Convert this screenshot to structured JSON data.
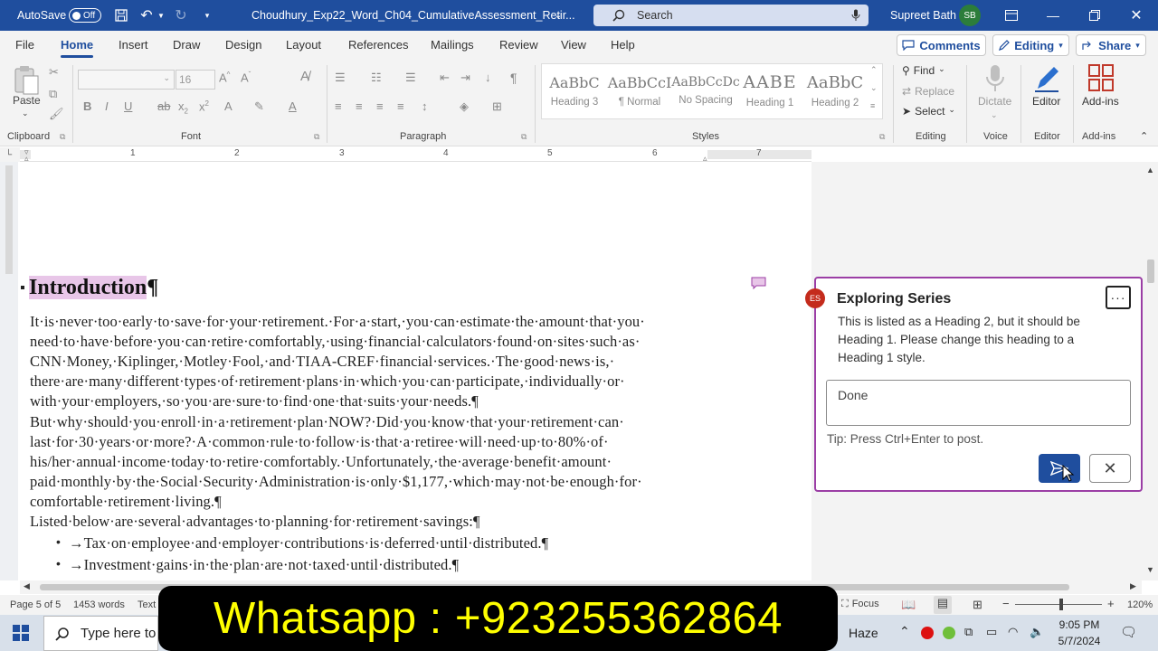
{
  "titlebar": {
    "autosave_label": "AutoSave",
    "autosave_state": "Off",
    "doc_title": "Choudhury_Exp22_Word_Ch04_CumulativeAssessment_Retir...",
    "search_placeholder": "Search",
    "user_name": "Supreet Bath",
    "user_initials": "SB"
  },
  "menu": {
    "tabs": [
      "File",
      "Home",
      "Insert",
      "Draw",
      "Design",
      "Layout",
      "References",
      "Mailings",
      "Review",
      "View",
      "Help"
    ],
    "active_tab": "Home",
    "comments_label": "Comments",
    "editing_label": "Editing",
    "share_label": "Share"
  },
  "ribbon": {
    "clipboard": {
      "paste": "Paste",
      "label": "Clipboard"
    },
    "font": {
      "size": "16",
      "label": "Font"
    },
    "paragraph": {
      "label": "Paragraph"
    },
    "styles": {
      "label": "Styles",
      "items": [
        {
          "preview": "AaBbC",
          "name": "Heading 3"
        },
        {
          "preview": "AaBbCcI",
          "name": "¶ Normal"
        },
        {
          "preview": "AaBbCcDc",
          "name": "No Spacing"
        },
        {
          "preview": "AABE",
          "name": "Heading 1"
        },
        {
          "preview": "AaBbC",
          "name": "Heading 2"
        }
      ]
    },
    "editing": {
      "find": "Find",
      "replace": "Replace",
      "select": "Select",
      "label": "Editing"
    },
    "voice": {
      "dictate": "Dictate",
      "label": "Voice"
    },
    "editor": {
      "editor": "Editor",
      "label": "Editor"
    },
    "addins": {
      "addins": "Add-ins",
      "label": "Add-ins"
    }
  },
  "ruler": {
    "numbers": [
      "1",
      "2",
      "3",
      "4",
      "5",
      "6",
      "7"
    ]
  },
  "document": {
    "heading": "Introduction",
    "lines": [
      "It·is·never·too·early·to·save·for·your·retirement.·For·a·start,·you·can·estimate·the·amount·that·you·",
      "need·to·have·before·you·can·retire·comfortably,·using·financial·calculators·found·on·sites·such·as·",
      "CNN·Money,·Kiplinger,·Motley·Fool,·and·TIAA-CREF·financial·services.·The·good·news·is,·",
      "there·are·many·different·types·of·retirement·plans·in·which·you·can·participate,·individually·or·",
      "with·your·employers,·so·you·are·sure·to·find·one·that·suits·your·needs.¶",
      "But·why·should·you·enroll·in·a·retirement·plan·NOW?·Did·you·know·that·your·retirement·can·",
      "last·for·30·years·or·more?·A·common·rule·to·follow·is·that·a·retiree·will·need·up·to·80%·of·",
      "his/her·annual·income·today·to·retire·comfortably.·Unfortunately,·the·average·benefit·amount·",
      "paid·monthly·by·the·Social·Security·Administration·is·only·$1,177,·which·may·not·be·enough·for·",
      "comfortable·retirement·living.¶",
      "Listed·below·are·several·advantages·to·planning·for·retirement·savings:¶"
    ],
    "bullets": [
      "→Tax·on·employee·and·employer·contributions·is·deferred·until·distributed.¶",
      "→Investment·gains·in·the·plan·are·not·taxed·until·distributed.¶"
    ]
  },
  "comment": {
    "initials": "ES",
    "author": "Exploring Series",
    "text_lines": [
      "This is listed as a Heading 2, but it should be",
      "Heading 1. Please change this heading to a",
      "Heading 1 style."
    ],
    "reply_value": "Done",
    "tip": "Tip: Press Ctrl+Enter to post."
  },
  "status": {
    "page": "Page 5 of 5",
    "words": "1453 words",
    "text_pred": "Text",
    "focus": "Focus",
    "zoom": "120%"
  },
  "overlay": {
    "text": "Whatsapp : +923255362864"
  },
  "taskbar": {
    "search_placeholder": "Type here to",
    "weather": "Haze",
    "time": "9:05 PM",
    "date": "5/7/2024"
  }
}
